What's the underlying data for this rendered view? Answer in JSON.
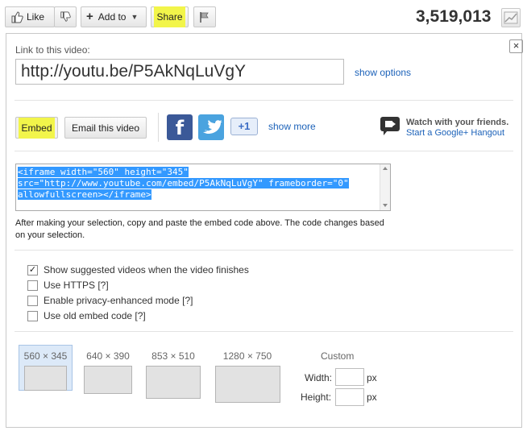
{
  "actions": {
    "like_label": "Like",
    "add_to_label": "Add to",
    "share_label": "Share",
    "view_count": "3,519,013"
  },
  "share_panel": {
    "close_glyph": "×",
    "link_label": "Link to this video:",
    "url": "http://youtu.be/P5AkNqLuVgY",
    "show_options": "show options",
    "embed_label": "Embed",
    "email_label": "Email this video",
    "social": [
      {
        "name": "facebook",
        "glyph": "f",
        "color": "#3b5998"
      },
      {
        "name": "twitter",
        "glyph": "t",
        "color": "#4aa3df"
      },
      {
        "name": "google-plus-one",
        "glyph": "+1",
        "color": "#dde8f8"
      }
    ],
    "show_more": "show more",
    "hangout_title": "Watch with your friends.",
    "hangout_link": "Start a Google+ Hangout"
  },
  "embed": {
    "code_line1": "<iframe width=\"560\" height=\"345\"",
    "code_line2": "src=\"http://www.youtube.com/embed/P5AkNqLuVgY\" frameborder=\"0\"",
    "code_line3": "allowfullscreen></iframe>",
    "help_text": "After making your selection, copy and paste the embed code above. The code changes based on your selection.",
    "options": [
      {
        "label": "Show suggested videos when the video finishes",
        "checked": true
      },
      {
        "label": "Use HTTPS [?]",
        "checked": false
      },
      {
        "label": "Enable privacy-enhanced mode [?]",
        "checked": false
      },
      {
        "label": "Use old embed code [?]",
        "checked": false
      }
    ],
    "sizes": [
      {
        "label": "560 × 345",
        "selected": true
      },
      {
        "label": "640 × 390",
        "selected": false
      },
      {
        "label": "853 × 510",
        "selected": false
      },
      {
        "label": "1280 × 750",
        "selected": false
      }
    ],
    "custom": {
      "title": "Custom",
      "width_label": "Width:",
      "height_label": "Height:",
      "unit": "px"
    }
  },
  "colors": {
    "highlight": "#f2f54a",
    "link": "#1c62b9",
    "selection": "#3399ff"
  }
}
